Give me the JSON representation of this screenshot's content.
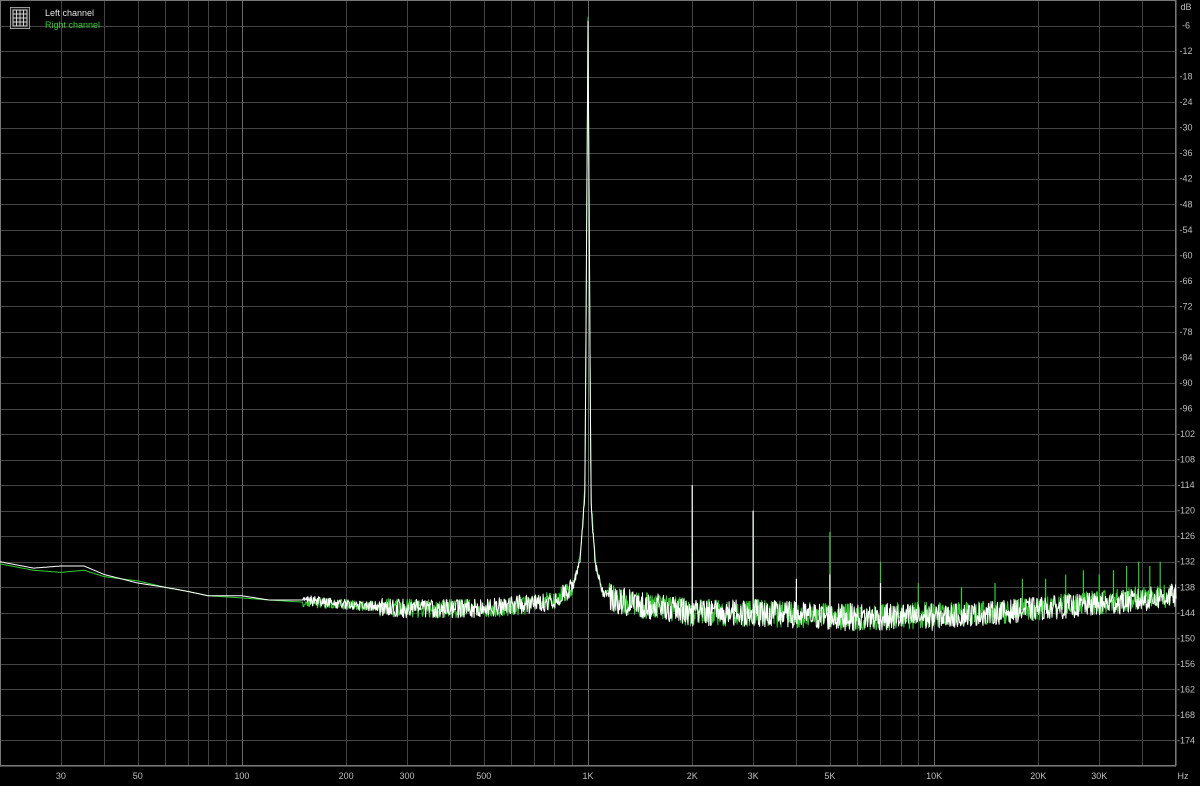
{
  "chart_data": {
    "type": "line",
    "title": "",
    "xlabel": "Hz",
    "ylabel": "dB",
    "x_scale": "log",
    "xlim": [
      20,
      50000
    ],
    "ylim": [
      -180,
      0
    ],
    "grid": true,
    "legend_position": "top-left",
    "x_ticks": [
      {
        "value": 30,
        "label": "30"
      },
      {
        "value": 50,
        "label": "50"
      },
      {
        "value": 100,
        "label": "100"
      },
      {
        "value": 200,
        "label": "200"
      },
      {
        "value": 300,
        "label": "300"
      },
      {
        "value": 500,
        "label": "500"
      },
      {
        "value": 1000,
        "label": "1K"
      },
      {
        "value": 2000,
        "label": "2K"
      },
      {
        "value": 3000,
        "label": "3K"
      },
      {
        "value": 5000,
        "label": "5K"
      },
      {
        "value": 10000,
        "label": "10K"
      },
      {
        "value": 20000,
        "label": "20K"
      },
      {
        "value": 30000,
        "label": "30K"
      }
    ],
    "y_ticks": [
      -6,
      -12,
      -18,
      -24,
      -30,
      -36,
      -42,
      -48,
      -54,
      -60,
      -66,
      -72,
      -78,
      -84,
      -90,
      -96,
      -102,
      -108,
      -114,
      -120,
      -126,
      -132,
      -138,
      -144,
      -150,
      -156,
      -162,
      -168,
      -174
    ],
    "series": [
      {
        "name": "Left channel",
        "color": "#ffffff",
        "points": [
          [
            20,
            -132
          ],
          [
            25,
            -133.5
          ],
          [
            30,
            -133
          ],
          [
            35,
            -133
          ],
          [
            40,
            -135
          ],
          [
            50,
            -137
          ],
          [
            60,
            -138
          ],
          [
            70,
            -139
          ],
          [
            80,
            -140
          ],
          [
            100,
            -140
          ],
          [
            120,
            -141
          ],
          [
            150,
            -141
          ],
          [
            200,
            -142
          ],
          [
            300,
            -143
          ],
          [
            400,
            -143
          ],
          [
            500,
            -143
          ],
          [
            600,
            -142
          ],
          [
            700,
            -142
          ],
          [
            800,
            -141
          ],
          [
            900,
            -138
          ],
          [
            950,
            -132
          ],
          [
            980,
            -115
          ],
          [
            1000,
            -5
          ],
          [
            1020,
            -118
          ],
          [
            1050,
            -133
          ],
          [
            1100,
            -139
          ],
          [
            1200,
            -141
          ],
          [
            1400,
            -142
          ],
          [
            1700,
            -143
          ],
          [
            2000,
            -144
          ],
          [
            3000,
            -144
          ],
          [
            4000,
            -144.5
          ],
          [
            5000,
            -145
          ],
          [
            7000,
            -145
          ],
          [
            10000,
            -145
          ],
          [
            15000,
            -144
          ],
          [
            20000,
            -143
          ],
          [
            30000,
            -142
          ],
          [
            40000,
            -141
          ],
          [
            48000,
            -140
          ]
        ],
        "spikes": [
          {
            "x": 2000,
            "y": -114
          },
          {
            "x": 3000,
            "y": -120
          },
          {
            "x": 4000,
            "y": -136
          },
          {
            "x": 5000,
            "y": -135
          },
          {
            "x": 7000,
            "y": -137
          }
        ]
      },
      {
        "name": "Right channel",
        "color": "#33cc33",
        "points": [
          [
            20,
            -132.5
          ],
          [
            25,
            -134
          ],
          [
            30,
            -134.5
          ],
          [
            35,
            -134
          ],
          [
            40,
            -135.5
          ],
          [
            50,
            -136.5
          ],
          [
            60,
            -138
          ],
          [
            70,
            -139
          ],
          [
            80,
            -140
          ],
          [
            100,
            -140.5
          ],
          [
            120,
            -141
          ],
          [
            150,
            -141.5
          ],
          [
            200,
            -142
          ],
          [
            300,
            -143
          ],
          [
            400,
            -143
          ],
          [
            500,
            -143
          ],
          [
            600,
            -142.5
          ],
          [
            700,
            -142
          ],
          [
            800,
            -141
          ],
          [
            900,
            -138
          ],
          [
            950,
            -131
          ],
          [
            980,
            -114
          ],
          [
            1000,
            -4
          ],
          [
            1020,
            -117
          ],
          [
            1050,
            -132
          ],
          [
            1100,
            -139
          ],
          [
            1200,
            -141
          ],
          [
            1400,
            -142
          ],
          [
            1700,
            -143
          ],
          [
            2000,
            -144
          ],
          [
            3000,
            -144
          ],
          [
            4000,
            -144.5
          ],
          [
            5000,
            -145
          ],
          [
            7000,
            -145
          ],
          [
            10000,
            -144.5
          ],
          [
            15000,
            -144
          ],
          [
            20000,
            -143
          ],
          [
            30000,
            -141.5
          ],
          [
            40000,
            -140.5
          ],
          [
            48000,
            -140
          ]
        ],
        "spikes": [
          {
            "x": 2000,
            "y": -130
          },
          {
            "x": 3000,
            "y": -122
          },
          {
            "x": 4000,
            "y": -138
          },
          {
            "x": 5000,
            "y": -125
          },
          {
            "x": 7000,
            "y": -132
          },
          {
            "x": 9000,
            "y": -137
          },
          {
            "x": 12000,
            "y": -138
          },
          {
            "x": 15000,
            "y": -137
          },
          {
            "x": 18000,
            "y": -136
          },
          {
            "x": 21000,
            "y": -136
          },
          {
            "x": 24000,
            "y": -135
          },
          {
            "x": 27000,
            "y": -134
          },
          {
            "x": 30000,
            "y": -135
          },
          {
            "x": 33000,
            "y": -134
          },
          {
            "x": 36000,
            "y": -133
          },
          {
            "x": 39000,
            "y": -132
          },
          {
            "x": 42000,
            "y": -133
          },
          {
            "x": 45000,
            "y": -132
          }
        ]
      }
    ]
  },
  "legend": {
    "left_label": "Left channel",
    "right_label": "Right channel",
    "icon": "grid-icon"
  }
}
